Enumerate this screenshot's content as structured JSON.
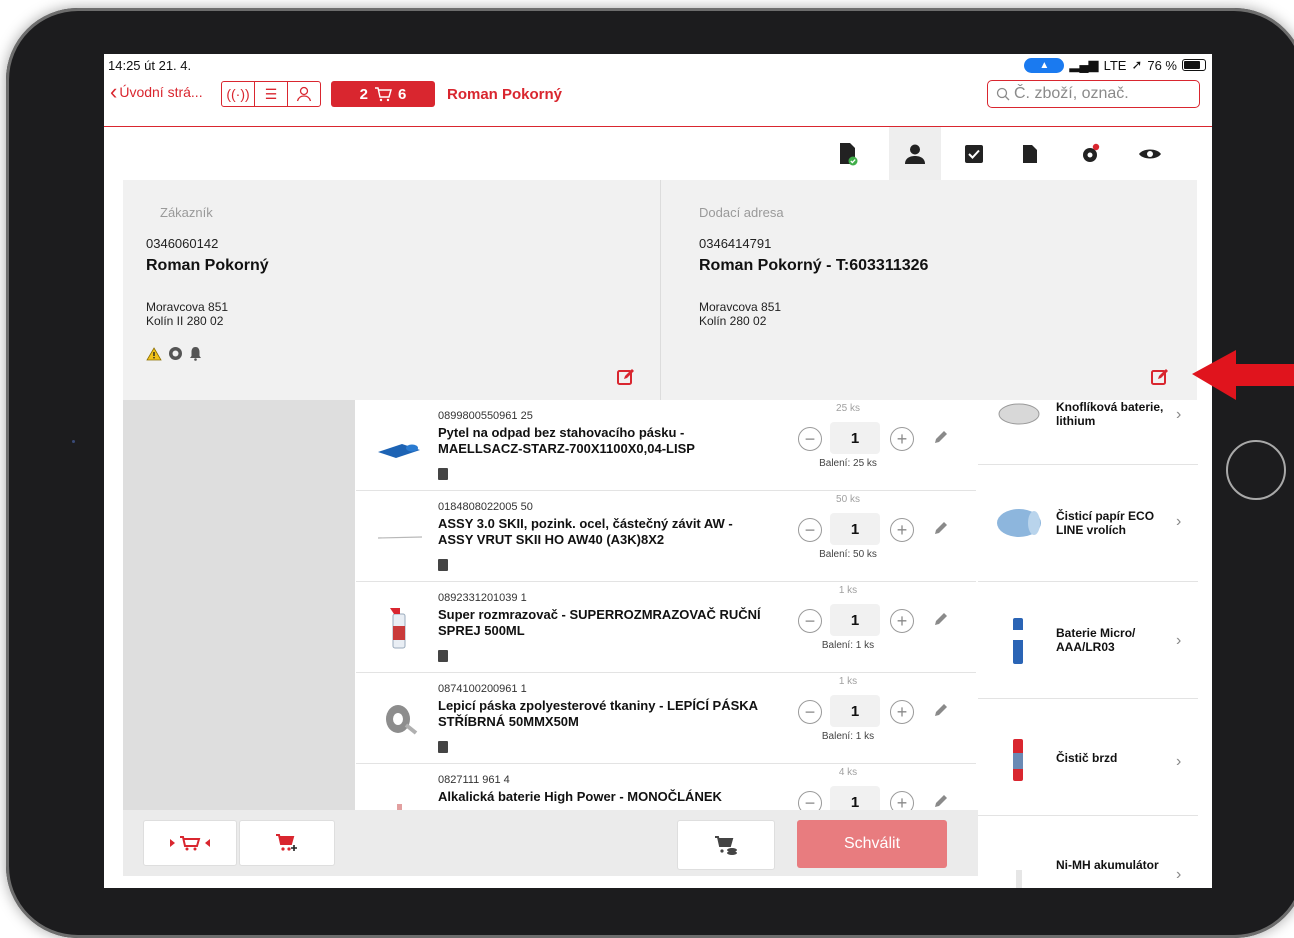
{
  "status": {
    "time": "14:25  út 21. 4.",
    "carrier": "LTE",
    "battery": "76 %"
  },
  "nav": {
    "back_label": "Úvodní strá...",
    "cart_left": "2",
    "cart_right": "6",
    "customer_name": "Roman Pokorný",
    "search_placeholder": "Č. zboží, označ."
  },
  "customer": {
    "label": "Zákazník",
    "number": "0346060142",
    "name": "Roman Pokorný",
    "street": "Moravcova 851",
    "city": "Kolín II  280 02"
  },
  "delivery": {
    "label": "Dodací adresa",
    "number": "0346414791",
    "name": "Roman Pokorný - T:603311326",
    "street": "Moravcova 851",
    "city": "Kolín  280 02"
  },
  "items": [
    {
      "code": "0899800550961  25",
      "title": "Pytel na odpad bez stahovacího pásku - MAELLSACZ-STARZ-700X1100X0,04-LISP",
      "qty_label": "25 ks",
      "qty": "1",
      "pack": "Balení: 25 ks"
    },
    {
      "code": "0184808022005  50",
      "title": "ASSY 3.0 SKII, pozink. ocel, částečný závit AW - ASSY VRUT SKII HO AW40 (A3K)8X2",
      "qty_label": "50 ks",
      "qty": "1",
      "pack": "Balení: 50 ks"
    },
    {
      "code": "0892331201039  1",
      "title": "Super rozmrazovač - SUPERROZMRAZOVAČ RUČNÍ SPREJ 500ML",
      "qty_label": "1 ks",
      "qty": "1",
      "pack": "Balení: 1 ks"
    },
    {
      "code": "0874100200961  1",
      "title": "Lepicí páska zpolyesterové tkaniny - LEPÍCÍ PÁSKA STŘÍBRNÁ 50MMX50M",
      "qty_label": "1 ks",
      "qty": "1",
      "pack": "Balení: 1 ks"
    },
    {
      "code": "0827111  961  4",
      "title": "Alkalická baterie High Power - MONOČLÁNEK",
      "qty_label": "4 ks",
      "qty": "1",
      "pack": ""
    }
  ],
  "recos": [
    {
      "name": "Knoflíková baterie, lithium"
    },
    {
      "name": "Čisticí papír ECO LINE vrolích"
    },
    {
      "name": "Baterie Micro/ AAA/LR03"
    },
    {
      "name": "Čistič brzd"
    },
    {
      "name": "Ni-MH akumulátor"
    }
  ],
  "actions": {
    "approve": "Schválit"
  },
  "colors": {
    "accent": "#d9262f",
    "approve_bg": "#e87c7f",
    "panel_bg": "#f1f1f1"
  }
}
